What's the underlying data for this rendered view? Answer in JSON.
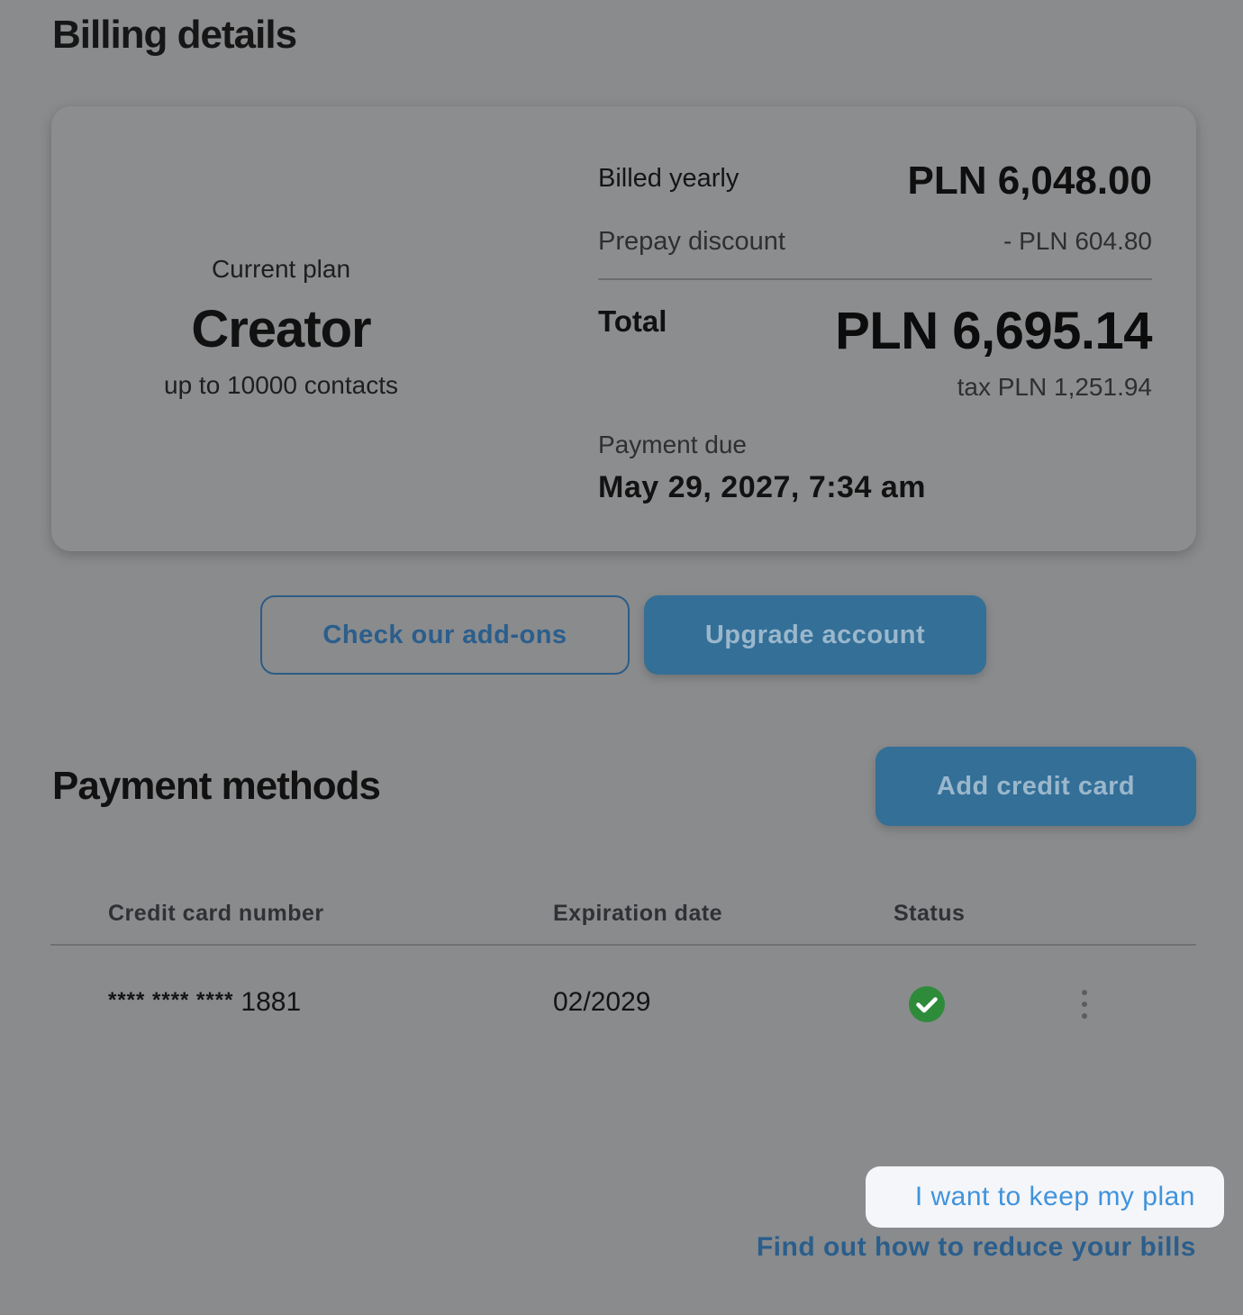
{
  "billing": {
    "title": "Billing details",
    "plan": {
      "caption": "Current plan",
      "name": "Creator",
      "limit": "up to 10000 contacts"
    },
    "summary": {
      "billed_label": "Billed yearly",
      "billed_value": "PLN 6,048.00",
      "discount_label": "Prepay discount",
      "discount_value": "- PLN 604.80",
      "total_label": "Total",
      "total_value": "PLN 6,695.14",
      "tax": "tax PLN 1,251.94",
      "due_label": "Payment due",
      "due_date": "May 29, 2027, 7:34 am"
    },
    "actions": {
      "addons_label": "Check our add-ons",
      "upgrade_label": "Upgrade account"
    }
  },
  "payment_methods": {
    "title": "Payment methods",
    "add_card_label": "Add credit card",
    "columns": {
      "card": "Credit card number",
      "expiration": "Expiration date",
      "status": "Status"
    },
    "rows": [
      {
        "card_mask": "**** **** ****",
        "card_last4": "1881",
        "expiration": "02/2029",
        "status_icon": "check-circle-icon"
      }
    ]
  },
  "footer": {
    "keep_plan_label": "I want to keep my plan",
    "reduce_link": "Find out how to reduce your bills"
  },
  "colors": {
    "overlay_background": "#8a8b8d",
    "primary_button": "#336f97",
    "link_blue": "#2a5e8c",
    "highlight_link": "#3f93dd",
    "status_ok": "#2e8b3a"
  }
}
